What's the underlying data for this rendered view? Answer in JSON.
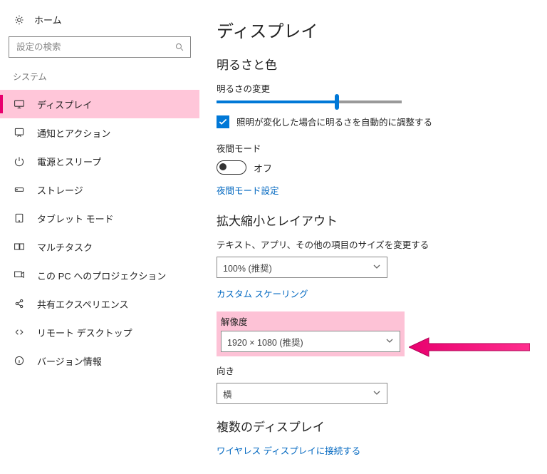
{
  "sidebar": {
    "home": "ホーム",
    "search_placeholder": "設定の検索",
    "section": "システム",
    "items": [
      {
        "label": "ディスプレイ",
        "selected": true
      },
      {
        "label": "通知とアクション"
      },
      {
        "label": "電源とスリープ"
      },
      {
        "label": "ストレージ"
      },
      {
        "label": "タブレット モード"
      },
      {
        "label": "マルチタスク"
      },
      {
        "label": "この PC へのプロジェクション"
      },
      {
        "label": "共有エクスペリエンス"
      },
      {
        "label": "リモート デスクトップ"
      },
      {
        "label": "バージョン情報"
      }
    ]
  },
  "main": {
    "title": "ディスプレイ",
    "brightness_section": "明るさと色",
    "brightness_change": "明るさの変更",
    "brightness_pct": 65,
    "auto_brightness": "照明が変化した場合に明るさを自動的に調整する",
    "night_mode": "夜間モード",
    "off": "オフ",
    "night_mode_settings": "夜間モード設定",
    "scale_section": "拡大縮小とレイアウト",
    "scale_label": "テキスト、アプリ、その他の項目のサイズを変更する",
    "scale_value": "100% (推奨)",
    "custom_scaling": "カスタム スケーリング",
    "resolution_label": "解像度",
    "resolution_value": "1920 × 1080 (推奨)",
    "orientation_label": "向き",
    "orientation_value": "横",
    "multi_display_section": "複数のディスプレイ",
    "wireless_display": "ワイヤレス ディスプレイに接続する"
  },
  "colors": {
    "accent": "#0078d7",
    "highlight": "#fdc2d6",
    "arrow": "#e8006e"
  }
}
